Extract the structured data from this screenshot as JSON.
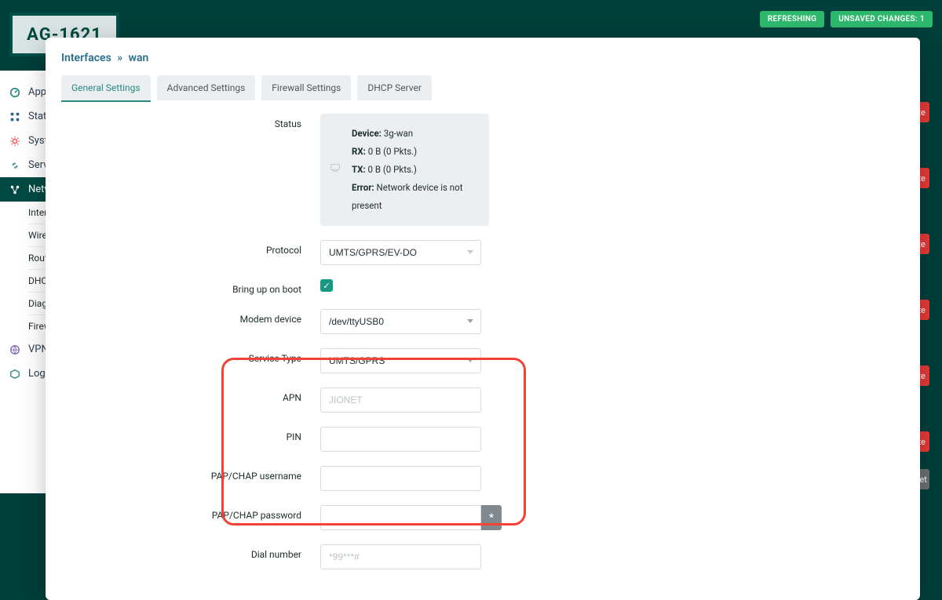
{
  "logo": "AG-1621",
  "top_badges": {
    "refreshing": "REFRESHING",
    "unsaved": "UNSAVED CHANGES:",
    "unsaved_count": "1"
  },
  "sidebar": {
    "items": [
      {
        "label": "Appl…",
        "icon": "dashboard"
      },
      {
        "label": "Statu…",
        "icon": "grid"
      },
      {
        "label": "Syste…",
        "icon": "gear"
      },
      {
        "label": "Servi…",
        "icon": "link"
      },
      {
        "label": "Netw…",
        "icon": "share",
        "active": true,
        "sub": [
          {
            "label": "Interf…"
          },
          {
            "label": "Wirele…"
          },
          {
            "label": "Routi…"
          },
          {
            "label": "DHCP…"
          },
          {
            "label": "Diagn…"
          },
          {
            "label": "Firew…"
          }
        ]
      },
      {
        "label": "VPN",
        "icon": "globe"
      },
      {
        "label": "Log o…",
        "icon": "box"
      }
    ]
  },
  "bg_buttons": {
    "delete": "elete",
    "reset": "Reset"
  },
  "modal": {
    "title_a": "Interfaces",
    "title_sep": "»",
    "title_b": "wan",
    "tabs": [
      {
        "label": "General Settings",
        "active": true
      },
      {
        "label": "Advanced Settings"
      },
      {
        "label": "Firewall Settings"
      },
      {
        "label": "DHCP Server"
      }
    ],
    "form": {
      "status": {
        "label": "Status",
        "device_k": "Device:",
        "device_v": "3g-wan",
        "rx_k": "RX:",
        "rx_v": "0 B (0 Pkts.)",
        "tx_k": "TX:",
        "tx_v": "0 B (0 Pkts.)",
        "err_k": "Error:",
        "err_v": "Network device is not present"
      },
      "protocol": {
        "label": "Protocol",
        "value": "UMTS/GPRS/EV-DO"
      },
      "bring_up": {
        "label": "Bring up on boot",
        "checked": true
      },
      "modem_device": {
        "label": "Modem device",
        "value": "/dev/ttyUSB0"
      },
      "service_type": {
        "label": "Service Type",
        "value": "UMTS/GPRS"
      },
      "apn": {
        "label": "APN",
        "value": "JIONET"
      },
      "pin": {
        "label": "PIN",
        "value": ""
      },
      "pap_user": {
        "label": "PAP/CHAP username",
        "value": ""
      },
      "pap_pass": {
        "label": "PAP/CHAP password",
        "value": ""
      },
      "dial": {
        "label": "Dial number",
        "placeholder": "*99***#"
      }
    }
  }
}
